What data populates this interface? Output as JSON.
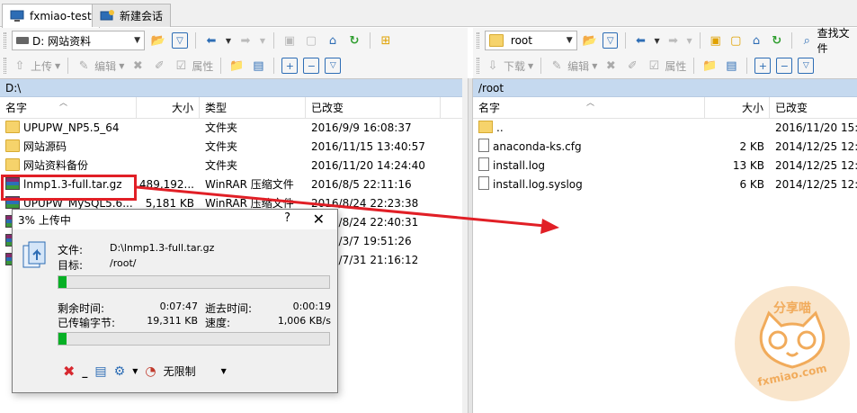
{
  "tabs": [
    {
      "label": "fxmiao-test",
      "active": true
    },
    {
      "label": "新建会话",
      "active": false
    }
  ],
  "left": {
    "drive_combo": "D: 网站资料",
    "upload_label": "上传",
    "edit_label": "编辑",
    "props_label": "属性",
    "path": "D:\\",
    "columns": {
      "name": "名字",
      "size": "大小",
      "type": "类型",
      "modified": "已改变"
    },
    "rows": [
      {
        "icon": "folder",
        "name": "UPUPW_NP5.5_64",
        "size": "",
        "type": "文件夹",
        "modified": "2016/9/9  16:08:37"
      },
      {
        "icon": "folder",
        "name": "网站源码",
        "size": "",
        "type": "文件夹",
        "modified": "2016/11/15  13:40:57"
      },
      {
        "icon": "folder",
        "name": "网站资料备份",
        "size": "",
        "type": "文件夹",
        "modified": "2016/11/20  14:24:40"
      },
      {
        "icon": "rar",
        "name": "lnmp1.3-full.tar.gz",
        "size": "489,192...",
        "type": "WinRAR 压缩文件",
        "modified": "2016/8/5  22:11:16"
      },
      {
        "icon": "rar",
        "name": "UPUPW_MySQL5.6...",
        "size": "5,181 KB",
        "type": "WinRAR 压缩文件",
        "modified": "2016/8/24  22:23:38"
      },
      {
        "icon": "rar",
        "name": "",
        "size": "",
        "type": "",
        "modified": "2016/8/24  22:40:31"
      },
      {
        "icon": "rar",
        "name": "",
        "size": "",
        "type": "",
        "modified": "2016/3/7  19:51:26"
      },
      {
        "icon": "rar",
        "name": "",
        "size": "",
        "type": "",
        "modified": "2016/7/31  21:16:12"
      }
    ]
  },
  "right": {
    "dir_combo": "root",
    "download_label": "下载",
    "edit_label": "编辑",
    "props_label": "属性",
    "find_label": "查找文件",
    "path": "/root",
    "columns": {
      "name": "名字",
      "size": "大小",
      "modified": "已改变"
    },
    "rows": [
      {
        "icon": "up",
        "name": "..",
        "size": "",
        "modified": "2016/11/20  15:5"
      },
      {
        "icon": "doc",
        "name": "anaconda-ks.cfg",
        "size": "2 KB",
        "modified": "2014/12/25  12:"
      },
      {
        "icon": "doc",
        "name": "install.log",
        "size": "13 KB",
        "modified": "2014/12/25  12:"
      },
      {
        "icon": "doc",
        "name": "install.log.syslog",
        "size": "6 KB",
        "modified": "2014/12/25  12:"
      }
    ]
  },
  "dialog": {
    "title": "3% 上传中",
    "help": "?",
    "close": "✕",
    "file_label": "文件:",
    "file_value": "D:\\lnmp1.3-full.tar.gz",
    "target_label": "目标:",
    "target_value": "/root/",
    "file_progress": 0.03,
    "remaining_label": "剩余时间:",
    "remaining_value": "0:07:47",
    "elapsed_label": "逝去时间:",
    "elapsed_value": "0:00:19",
    "transferred_label": "已传输字节:",
    "transferred_value": "19,311 KB",
    "speed_label": "速度:",
    "speed_value": "1,006 KB/s",
    "total_progress": 0.03,
    "limit_label": "无限制"
  },
  "watermark": {
    "top": "分享喵",
    "bottom": "fxmiao.com"
  },
  "colors": {
    "path_bar": "#c5d9ef",
    "progress": "#06b025",
    "highlight": "#e11f26"
  }
}
